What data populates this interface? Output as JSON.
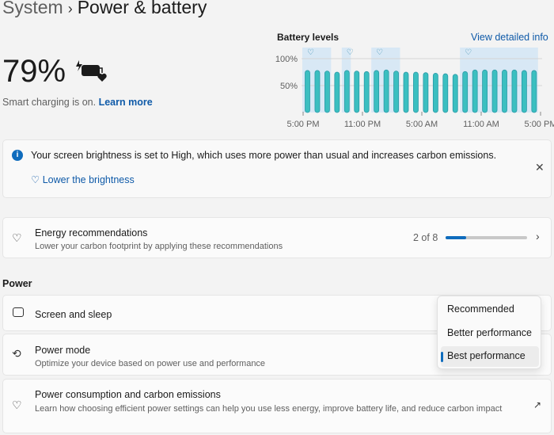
{
  "breadcrumb": {
    "parent": "System",
    "separator": "›",
    "current": "Power & battery"
  },
  "battery": {
    "percent": "79%",
    "status": "Smart charging is on.",
    "learn_more": "Learn more",
    "icon": "battery-charging-heart-icon"
  },
  "chart": {
    "title": "Battery levels",
    "link": "View detailed info",
    "y_ticks": [
      "100%",
      "50%"
    ],
    "x_ticks": [
      "5:00 PM",
      "11:00 PM",
      "5:00 AM",
      "11:00 AM",
      "5:00 PM"
    ],
    "values": [
      78,
      78,
      77,
      75,
      78,
      77,
      76,
      78,
      79,
      77,
      75,
      75,
      74,
      73,
      72,
      71,
      76,
      79,
      79,
      79,
      79,
      79,
      78,
      78
    ],
    "smart_charging_ranges": [
      [
        0,
        2
      ],
      [
        4,
        4
      ],
      [
        7,
        9
      ],
      [
        16,
        23
      ]
    ],
    "bar_color": "#3bbfc0",
    "shade_color": "#d8e8f5"
  },
  "banner": {
    "message": "Your screen brightness is set to High, which uses more power than usual and increases carbon emissions.",
    "action": "Lower the brightness"
  },
  "energy": {
    "title": "Energy recommendations",
    "subtitle": "Lower your carbon footprint by applying these recommendations",
    "progress_label": "2 of 8",
    "progress": 0.25
  },
  "power": {
    "section": "Power",
    "screen_sleep": "Screen and sleep",
    "mode_title": "Power mode",
    "mode_subtitle": "Optimize your device based on power use and performance",
    "consumption_title": "Power consumption and carbon emissions",
    "consumption_subtitle": "Learn how choosing efficient power settings can help you use less energy, improve battery life, and reduce carbon impact"
  },
  "dropdown": {
    "options": [
      "Recommended",
      "Better performance",
      "Best performance"
    ],
    "selected": "Best performance"
  }
}
